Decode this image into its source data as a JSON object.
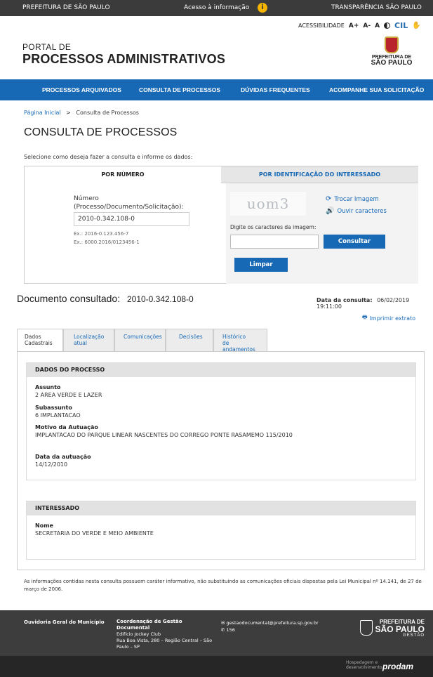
{
  "topbar": {
    "left": "PREFEITURA DE SÃO PAULO",
    "middle": "Acesso à informação",
    "right": "TRANSPARÊNCIA SÃO PAULO"
  },
  "accessibility": {
    "label": "ACESSIBILIDADE",
    "font_plus": "A+",
    "font_minus": "A-",
    "font_reset": "A",
    "cil": "CIL"
  },
  "header": {
    "line1": "PORTAL DE",
    "line2": "PROCESSOS ADMINISTRATIVOS",
    "logo_line1": "PREFEITURA DE",
    "logo_line2": "SÃO PAULO"
  },
  "nav": [
    "PROCESSOS ARQUIVADOS",
    "CONSULTA DE PROCESSOS",
    "DÚVIDAS FREQUENTES",
    "ACOMPANHE SUA SOLICITAÇÃO"
  ],
  "breadcrumb": {
    "home": "Página Inicial",
    "sep": ">",
    "current": "Consulta de Processos"
  },
  "page_title": "CONSULTA DE PROCESSOS",
  "instructions": "Selecione como deseja fazer a consulta e informe os dados:",
  "search": {
    "tab_number": "POR NÚMERO",
    "tab_interessado": "POR IDENTIFICAÇÃO DO INTERESSADO",
    "number_label_1": "Número",
    "number_label_2": "(Processo/Documento/Solicitação):",
    "number_value": "2010-0.342.108-0",
    "example_1": "Ex.: 2016-0.123.456-7",
    "example_2": "Ex.: 6000.2016/0123456-1",
    "captcha_text": "uom3",
    "change_image": "Trocar Imagem",
    "listen_chars": "Ouvir caracteres",
    "captcha_label": "Digite os caracteres da imagem:",
    "captcha_value": "",
    "submit": "Consultar",
    "clear": "Limpar"
  },
  "document": {
    "label": "Documento consultado:",
    "number": "2010-0.342.108-0",
    "date_label": "Data da consulta:",
    "date_value": "06/02/2019 19:11:00",
    "print": "Imprimir extrato"
  },
  "tabs": [
    {
      "l1": "Dados",
      "l2": "Cadastrais"
    },
    {
      "l1": "Localização",
      "l2": "atual"
    },
    {
      "l1": "Comunicações",
      "l2": ""
    },
    {
      "l1": "Decisões",
      "l2": ""
    },
    {
      "l1": "Histórico",
      "l2": "de andamentos"
    }
  ],
  "process": {
    "section_title": "DADOS DO PROCESSO",
    "assunto_label": "Assunto",
    "assunto_value": "2 AREA VERDE E LAZER",
    "subassunto_label": "Subassunto",
    "subassunto_value": "6 IMPLANTACAO",
    "motivo_label": "Motivo da Autuação",
    "motivo_value": "IMPLANTACAO DO PARQUE LINEAR NASCENTES DO CORREGO PONTE RASAMEMO 115/2010",
    "data_label": "Data da autuação",
    "data_value": "14/12/2010"
  },
  "interessado": {
    "section_title": "INTERESSADO",
    "nome_label": "Nome",
    "nome_value": "SECRETARIA DO VERDE E MEIO AMBIENTE"
  },
  "disclaimer": "As informações contidas nesta consulta possuem caráter informativo, não substituindo as comunicações oficiais dispostas pela Lei Municipal nº 14.141, de 27 de março de 2006.",
  "footer": {
    "ouvidoria": "Ouvidoria Geral do Município",
    "coord_title": "Coordenação de Gestão Documental",
    "coord_line1": "Edifício Jockey Club",
    "coord_line2": "Rua Boa Vista, 280 – Região Central – São Paulo – SP",
    "email": "gestaodocumental@prefeitura.sp.gov.br",
    "phone": "156",
    "logo_a": "PREFEITURA DE",
    "logo_b": "SÃO PAULO",
    "logo_c": "GESTÃO",
    "hosted_1": "Hospedagem e",
    "hosted_2": "desenvolvimento",
    "prodam": "prodam"
  }
}
